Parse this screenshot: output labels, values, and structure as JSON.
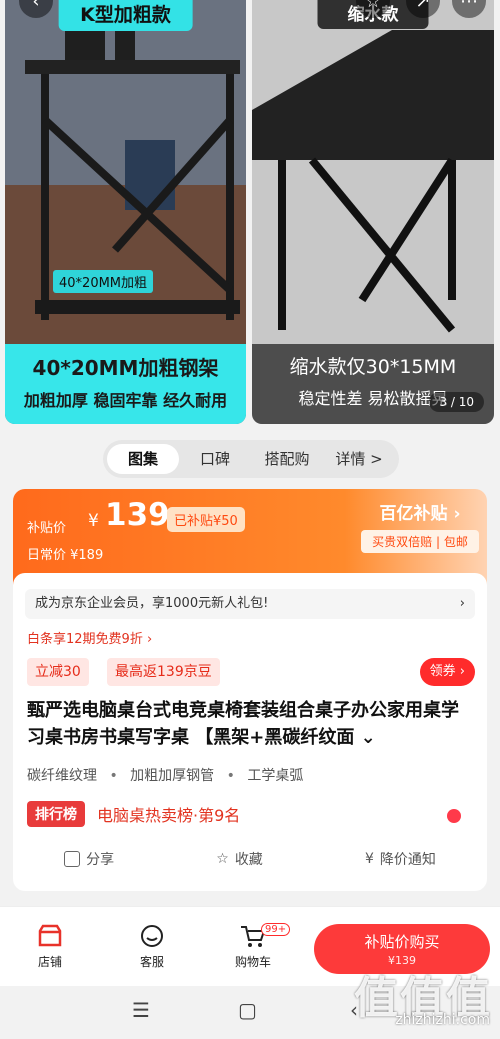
{
  "gallery": {
    "left": {
      "top_banner": "K型加粗款",
      "tag": "40*20MM加粗",
      "caption_main": "40*20MM加粗钢架",
      "caption_sub": "加粗加厚 稳固牢靠 经久耐用"
    },
    "right": {
      "top_banner": "缩水款",
      "caption_main": "缩水款仅30*15MM",
      "caption_sub": "稳定性差 易松散摇晃"
    },
    "counter": "3 / 10"
  },
  "tabs": [
    "图集",
    "口碑",
    "搭配购",
    "详情 >"
  ],
  "price": {
    "label": "补贴价",
    "currency": "¥",
    "value": "139",
    "badge": "已补贴¥50",
    "daily": "日常价 ¥189",
    "brand_title": "百亿补贴 ›",
    "brand_sub": "买贵双倍赔 | 包邮"
  },
  "promo": {
    "member_line": "成为京东企业会员，享1000元新人礼包!",
    "arrow": "›",
    "baitiao": "白条享12期免费9折 ›",
    "chip1": "立减30",
    "chip2": "最高返139京豆",
    "coupon": "领券 ›"
  },
  "product": {
    "title": "甄严选电脑桌台式电竞桌椅套装组合桌子办公家用桌学习桌书房书桌写字桌 【黑架+黑碳纤纹面 ⌄",
    "features": [
      "碳纤维纹理",
      "加粗加厚钢管",
      "工学桌弧"
    ],
    "rank_badge": "排行榜",
    "rank_text": "电脑桌热卖榜·第9名"
  },
  "actions": [
    "分享",
    "收藏",
    "降价通知"
  ],
  "bottom_bar": {
    "store": "店铺",
    "service": "客服",
    "cart": "购物车",
    "cart_badge": "99+",
    "buy_label": "补贴价购买",
    "buy_price": "¥139"
  },
  "watermark": {
    "main": "值值值",
    "sub": "zhizhizhi.com"
  },
  "colors": {
    "accent": "#ff2b2b",
    "price_gradient_start": "#ff6a1c",
    "cyan_caption": "#37e6ea"
  }
}
